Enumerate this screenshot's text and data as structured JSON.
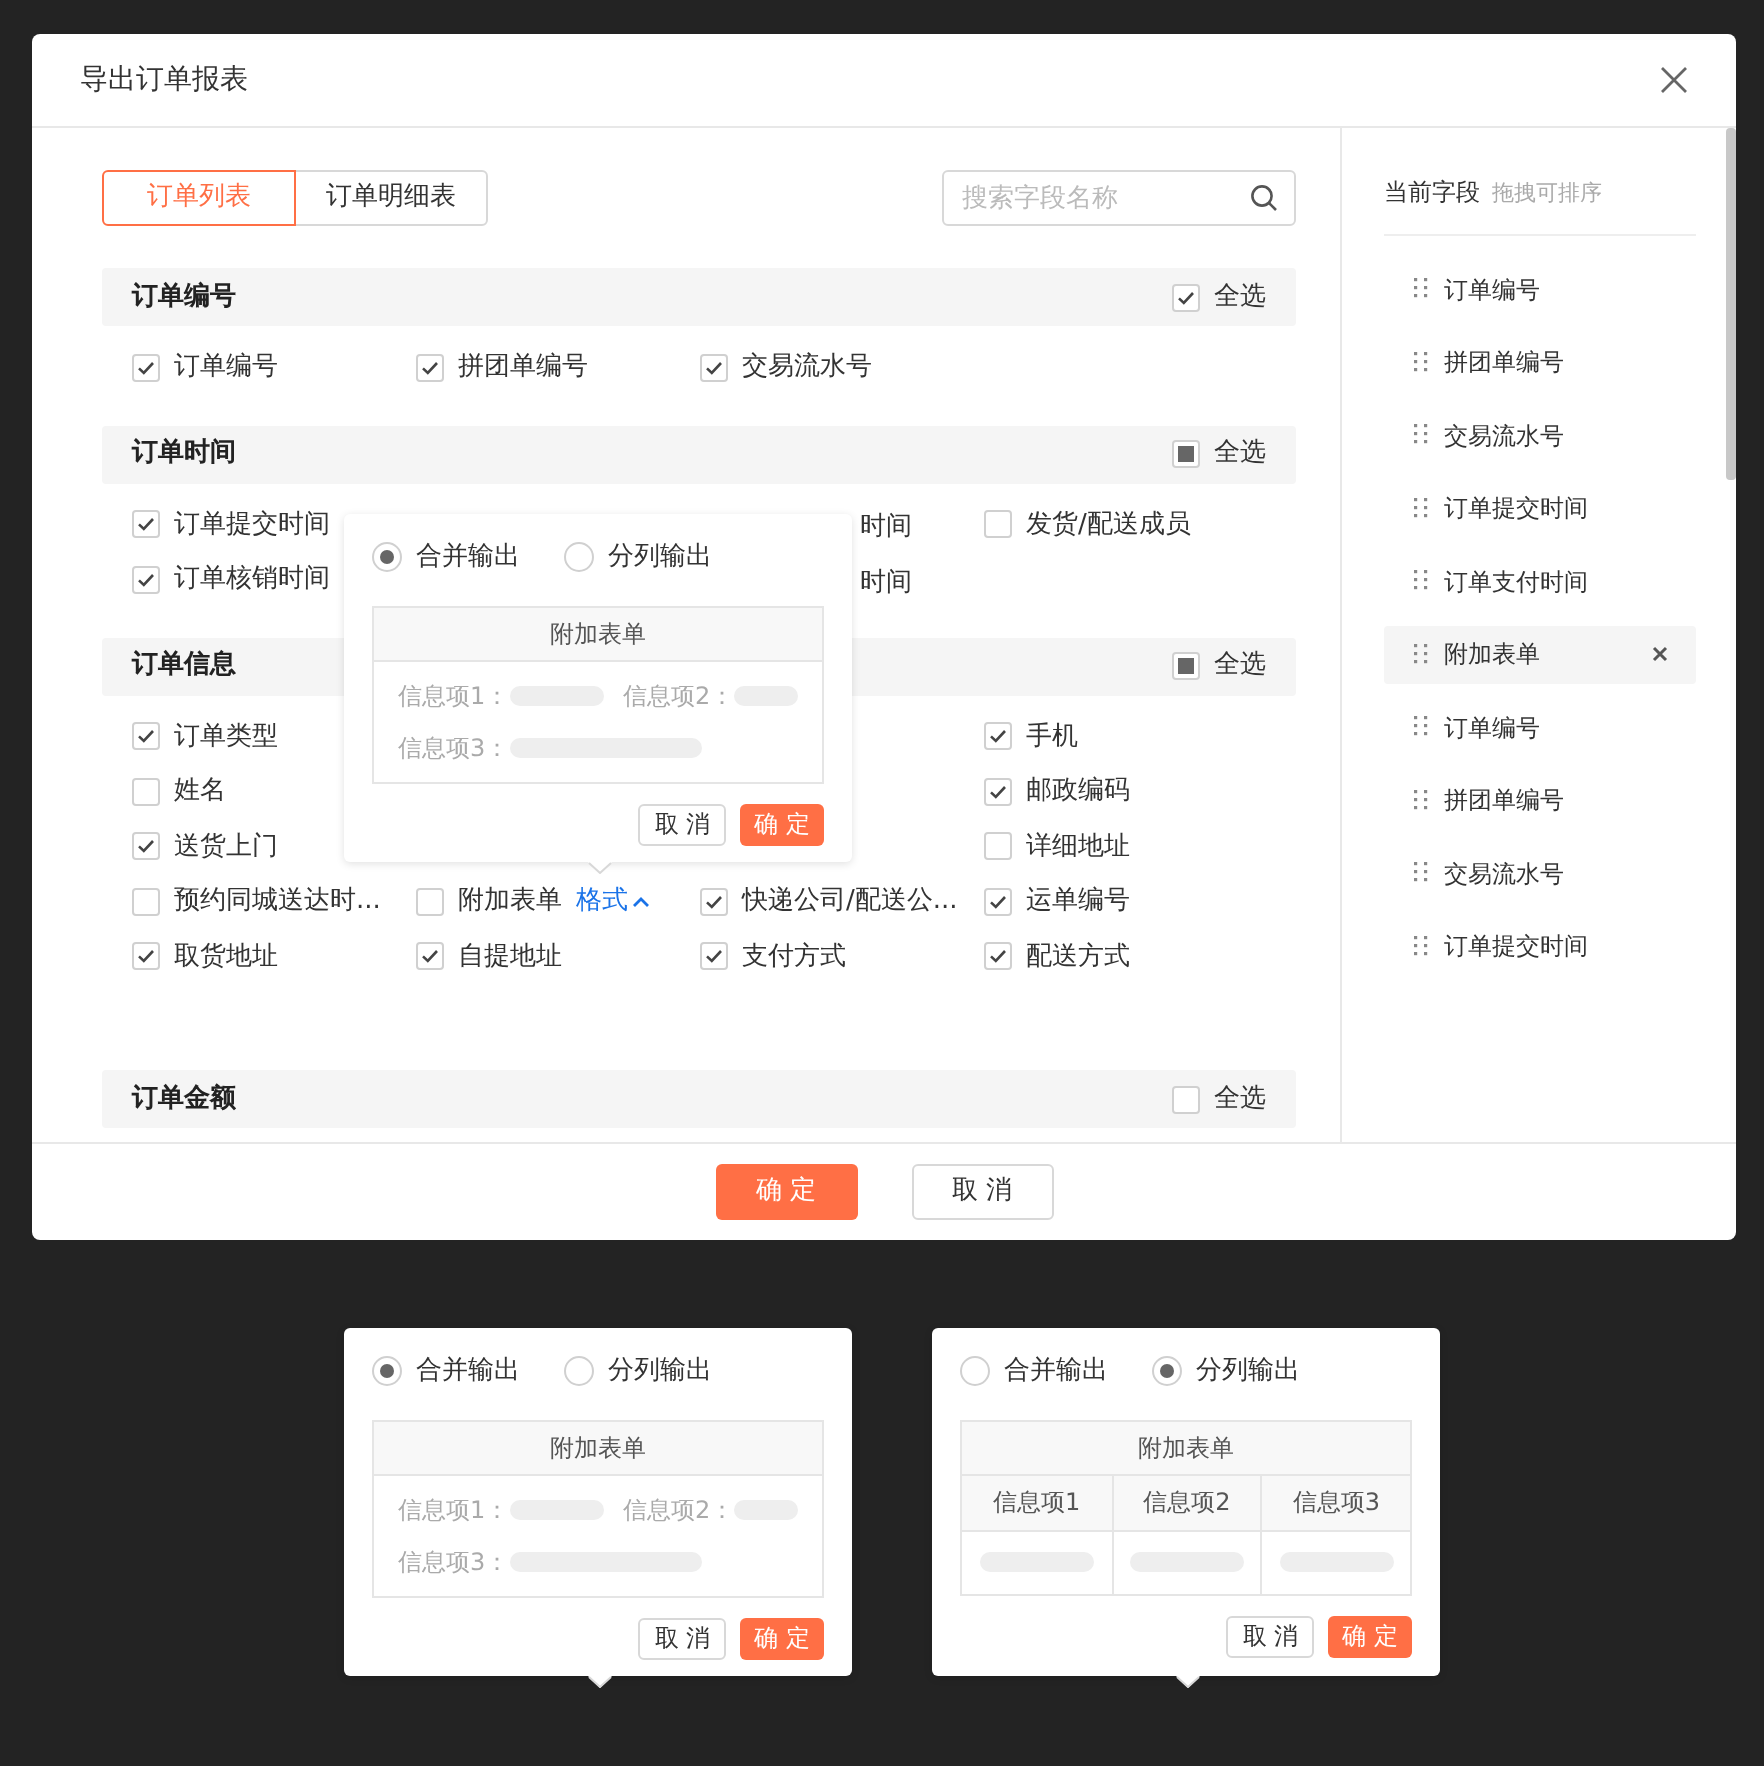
{
  "dialog": {
    "title": "导出订单报表",
    "tabs": [
      {
        "label": "订单列表",
        "selected": true
      },
      {
        "label": "订单明细表",
        "selected": false
      }
    ],
    "search": {
      "placeholder": "搜索字段名称"
    },
    "sections": [
      {
        "title": "订单编号",
        "select_all": {
          "label": "全选",
          "checked": true,
          "indeterminate": false
        },
        "rows": [
          [
            {
              "kind": "field",
              "label": "订单编号",
              "checked": true
            },
            {
              "kind": "field",
              "label": "拼团单编号",
              "checked": true
            },
            {
              "kind": "field",
              "label": "交易流水号",
              "checked": true
            },
            null
          ]
        ]
      },
      {
        "title": "订单时间",
        "select_all": {
          "label": "全选",
          "checked": false,
          "indeterminate": true
        },
        "rows": [
          [
            {
              "kind": "field",
              "label": "订单提交时间",
              "checked": true
            },
            null,
            {
              "kind": "covered",
              "label": "时间"
            },
            {
              "kind": "field",
              "label": "发货/配送成员",
              "checked": false
            }
          ],
          [
            {
              "kind": "field",
              "label": "订单核销时间",
              "checked": true
            },
            null,
            {
              "kind": "covered",
              "label": "时间"
            },
            null
          ]
        ]
      },
      {
        "title": "订单信息",
        "select_all": {
          "label": "全选",
          "checked": false,
          "indeterminate": true
        },
        "rows": [
          [
            {
              "kind": "field",
              "label": "订单类型",
              "checked": true
            },
            null,
            null,
            {
              "kind": "field",
              "label": "手机",
              "checked": true
            }
          ],
          [
            {
              "kind": "field",
              "label": "姓名",
              "checked": false
            },
            null,
            null,
            {
              "kind": "field",
              "label": "邮政编码",
              "checked": true
            }
          ],
          [
            {
              "kind": "field",
              "label": "送货上门",
              "checked": true
            },
            null,
            null,
            {
              "kind": "field",
              "label": "详细地址",
              "checked": false
            }
          ],
          [
            {
              "kind": "field",
              "label": "预约同城送达时...",
              "checked": false
            },
            {
              "kind": "field",
              "label": "附加表单",
              "checked": false,
              "link": "格式"
            },
            {
              "kind": "field",
              "label": "快递公司/配送公...",
              "checked": true
            },
            {
              "kind": "field",
              "label": "运单编号",
              "checked": true
            }
          ],
          [
            {
              "kind": "field",
              "label": "取货地址",
              "checked": true
            },
            {
              "kind": "field",
              "label": "自提地址",
              "checked": true
            },
            {
              "kind": "field",
              "label": "支付方式",
              "checked": true
            },
            {
              "kind": "field",
              "label": "配送方式",
              "checked": true
            }
          ]
        ]
      },
      {
        "title": "订单金额",
        "select_all": {
          "label": "全选",
          "checked": false,
          "indeterminate": false
        }
      }
    ],
    "current_fields": {
      "title": "当前字段",
      "hint": "拖拽可排序",
      "items": [
        {
          "label": "订单编号",
          "highlighted": false
        },
        {
          "label": "拼团单编号",
          "highlighted": false
        },
        {
          "label": "交易流水号",
          "highlighted": false
        },
        {
          "label": "订单提交时间",
          "highlighted": false
        },
        {
          "label": "订单支付时间",
          "highlighted": false
        },
        {
          "label": "附加表单",
          "highlighted": true
        },
        {
          "label": "订单编号",
          "highlighted": false
        },
        {
          "label": "拼团单编号",
          "highlighted": false
        },
        {
          "label": "交易流水号",
          "highlighted": false
        },
        {
          "label": "订单提交时间",
          "highlighted": false
        }
      ]
    },
    "buttons": [
      {
        "label": "确 定",
        "kind": "primary"
      },
      {
        "label": "取 消",
        "kind": "secondary"
      }
    ]
  },
  "popovers": [
    {
      "options": [
        {
          "label": "合并输出",
          "selected": true
        },
        {
          "label": "分列输出",
          "selected": false
        }
      ],
      "table": {
        "title": "附加表单",
        "kind": "merged",
        "fields": [
          "信息项1：",
          "信息项2：",
          "信息项3："
        ]
      },
      "buttons": [
        {
          "label": "取 消",
          "kind": "secondary"
        },
        {
          "label": "确 定",
          "kind": "primary"
        }
      ]
    },
    {
      "options": [
        {
          "label": "合并输出",
          "selected": true
        },
        {
          "label": "分列输出",
          "selected": false
        }
      ],
      "table": {
        "title": "附加表单",
        "kind": "merged",
        "fields": [
          "信息项1：",
          "信息项2：",
          "信息项3："
        ]
      },
      "buttons": [
        {
          "label": "取 消",
          "kind": "secondary"
        },
        {
          "label": "确 定",
          "kind": "primary"
        }
      ]
    },
    {
      "options": [
        {
          "label": "合并输出",
          "selected": false
        },
        {
          "label": "分列输出",
          "selected": true
        }
      ],
      "table": {
        "title": "附加表单",
        "kind": "split",
        "fields": [
          "信息项1",
          "信息项2",
          "信息项3"
        ]
      },
      "buttons": [
        {
          "label": "取 消",
          "kind": "secondary"
        },
        {
          "label": "确 定",
          "kind": "primary"
        }
      ]
    }
  ]
}
